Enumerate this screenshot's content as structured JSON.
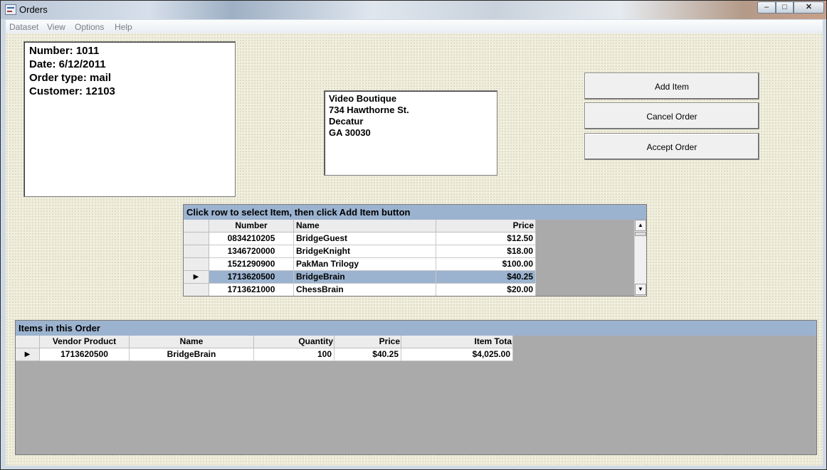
{
  "window": {
    "title": "Orders",
    "controls": {
      "minimize": "–",
      "maximize": "□",
      "close": "✕"
    }
  },
  "menu": [
    "Dataset",
    "View",
    "Options",
    "Help"
  ],
  "order_info": {
    "number_line": "Number:  1011",
    "date_line": "Date: 6/12/2011",
    "type_line": "Order type: mail",
    "customer_line": "Customer: 12103"
  },
  "address": {
    "line1": "Video Boutique",
    "line2": "734 Hawthorne St.",
    "line3": "Decatur",
    "line4": "GA  30030"
  },
  "buttons": {
    "add_item": "Add Item",
    "cancel_order": "Cancel Order",
    "accept_order": "Accept  Order"
  },
  "product_grid": {
    "caption": "Click row to select Item, then click Add Item button",
    "columns": [
      "Number",
      "Name",
      "Price"
    ],
    "rows": [
      {
        "number": "0834210205",
        "name": "BridgeGuest",
        "price": "$12.50",
        "selected": false
      },
      {
        "number": "1346720000",
        "name": "BridgeKnight",
        "price": "$18.00",
        "selected": false
      },
      {
        "number": "1521290900",
        "name": "PakMan Trilogy",
        "price": "$100.00",
        "selected": false
      },
      {
        "number": "1713620500",
        "name": "BridgeBrain",
        "price": "$40.25",
        "selected": true
      },
      {
        "number": "1713621000",
        "name": "ChessBrain",
        "price": "$20.00",
        "selected": false
      }
    ],
    "selector_glyph": "▶"
  },
  "order_grid": {
    "caption": "Items in this Order",
    "columns": [
      "Vendor Product",
      "Name",
      "Quantity",
      "Price",
      "Item Tota"
    ],
    "rows": [
      {
        "vendor_product": "1713620500",
        "name": "BridgeBrain",
        "quantity": "100",
        "price": "$40.25",
        "item_total": "$4,025.00"
      }
    ],
    "selector_glyph": "▶"
  },
  "colors": {
    "grid_caption": "#9bb3cf",
    "selected_row": "#9bb3cf",
    "grid_empty": "#aaaaaa",
    "client_bg": "#efeddc"
  }
}
